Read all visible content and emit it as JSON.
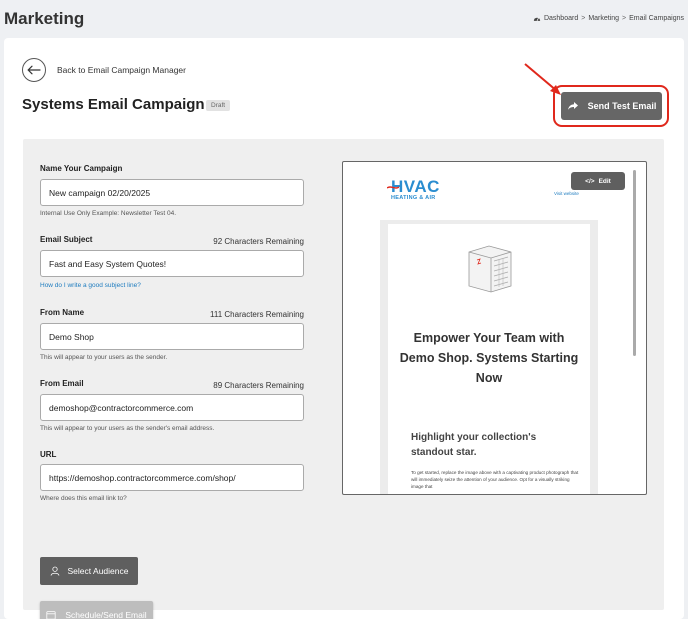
{
  "app": {
    "title": "Marketing"
  },
  "breadcrumb": {
    "items": [
      "Dashboard",
      "Marketing",
      "Email Campaigns"
    ],
    "separator": ">"
  },
  "header": {
    "back_label": "Back to Email Campaign Manager",
    "campaign_title": "Systems Email Campaign",
    "status_badge": "Draft",
    "send_test_label": "Send Test Email"
  },
  "form": {
    "name": {
      "label": "Name Your Campaign",
      "value": "New campaign 02/20/2025",
      "help": "Internal Use Only Example: Newsletter Test 04."
    },
    "subject": {
      "label": "Email Subject",
      "remaining": "92 Characters Remaining",
      "value": "Fast and Easy System Quotes!",
      "link": "How do I write a good subject line?"
    },
    "from_name": {
      "label": "From Name",
      "remaining": "111 Characters Remaining",
      "value": "Demo Shop",
      "help": "This will appear to your users as the sender."
    },
    "from_email": {
      "label": "From Email",
      "remaining": "89 Characters Remaining",
      "value": "demoshop@contractorcommerce.com",
      "help": "This will appear to your users as the sender's email address."
    },
    "url": {
      "label": "URL",
      "value": "https://demoshop.contractorcommerce.com/shop/",
      "help": "Where does this email link to?"
    },
    "select_audience_label": "Select Audience",
    "schedule_label": "Schedule/Send Email"
  },
  "preview": {
    "logo_main": "HVAC",
    "logo_sub": "HEATING & AIR",
    "visit_link": "Visit website",
    "edit_label": "Edit",
    "headline": "Empower Your Team with Demo Shop. Systems Starting Now",
    "subhead": "Highlight your collection's standout star.",
    "paragraph": "To get started, replace the image above with a captivating product photograph that will immediately seize the attention of your audience. Opt for a visually striking image that"
  },
  "colors": {
    "button_dark": "#666666",
    "annotation_red": "#e0281c",
    "link_blue": "#1e7cbf",
    "logo_blue": "#2a8dd0"
  }
}
